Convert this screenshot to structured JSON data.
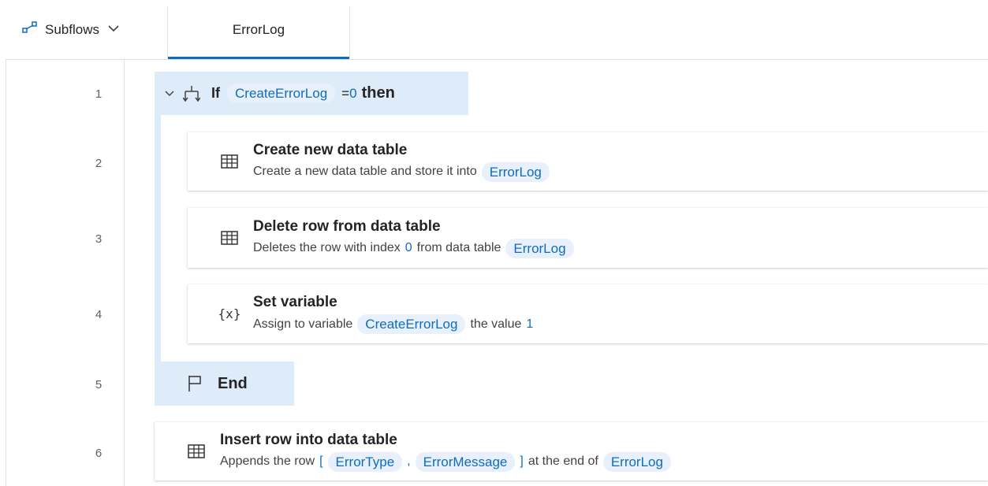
{
  "header": {
    "subflows_label": "Subflows",
    "active_tab": "ErrorLog"
  },
  "lines": [
    "1",
    "2",
    "3",
    "4",
    "5",
    "6"
  ],
  "if_block": {
    "keyword_if": "If",
    "variable": "CreateErrorLog",
    "operator": "=",
    "value": "0",
    "keyword_then": "then"
  },
  "actions": [
    {
      "title": "Create new data table",
      "desc_prefix": "Create a new data table and store it into",
      "variable": "ErrorLog",
      "icon": "table-icon"
    },
    {
      "title": "Delete row from data table",
      "desc_prefix": "Deletes the row with index",
      "index": "0",
      "desc_middle": "from data table",
      "variable": "ErrorLog",
      "icon": "table-icon"
    },
    {
      "title": "Set variable",
      "desc_prefix": "Assign to variable",
      "variable": "CreateErrorLog",
      "desc_middle": "the value",
      "value": "1",
      "icon": "variable-icon",
      "icon_text": "{x}"
    },
    {
      "title": "Insert row into data table",
      "desc_prefix": "Appends the row",
      "open_bracket": "[",
      "var1": "ErrorType",
      "comma": ",",
      "var2": "ErrorMessage",
      "close_bracket": "]",
      "desc_middle": "at the end of",
      "variable": "ErrorLog",
      "icon": "table-icon"
    }
  ],
  "end_block": {
    "label": "End"
  }
}
